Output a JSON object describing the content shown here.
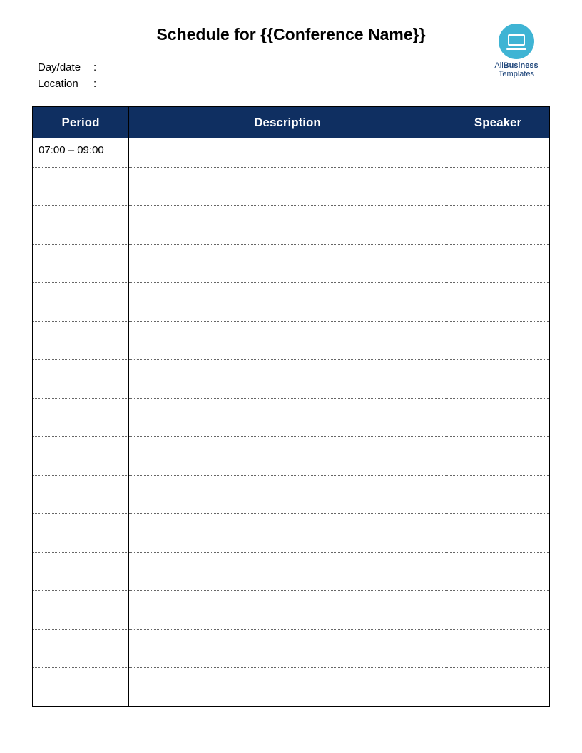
{
  "title": "Schedule for {{Conference Name}}",
  "meta": {
    "daydate_label": "Day/date",
    "daydate_value": "",
    "location_label": "Location",
    "location_value": "",
    "colon": ":"
  },
  "logo": {
    "line1_prefix": "All",
    "line1_bold": "Business",
    "line2": "Templates"
  },
  "columns": {
    "period": "Period",
    "description": "Description",
    "speaker": "Speaker"
  },
  "rows": [
    {
      "period": "07:00 – 09:00",
      "description": "",
      "speaker": ""
    },
    {
      "period": "",
      "description": "",
      "speaker": ""
    },
    {
      "period": "",
      "description": "",
      "speaker": ""
    },
    {
      "period": "",
      "description": "",
      "speaker": ""
    },
    {
      "period": "",
      "description": "",
      "speaker": ""
    },
    {
      "period": "",
      "description": "",
      "speaker": ""
    },
    {
      "period": "",
      "description": "",
      "speaker": ""
    },
    {
      "period": "",
      "description": "",
      "speaker": ""
    },
    {
      "period": "",
      "description": "",
      "speaker": ""
    },
    {
      "period": "",
      "description": "",
      "speaker": ""
    },
    {
      "period": "",
      "description": "",
      "speaker": ""
    },
    {
      "period": "",
      "description": "",
      "speaker": ""
    },
    {
      "period": "",
      "description": "",
      "speaker": ""
    },
    {
      "period": "",
      "description": "",
      "speaker": ""
    },
    {
      "period": "",
      "description": "",
      "speaker": ""
    }
  ]
}
